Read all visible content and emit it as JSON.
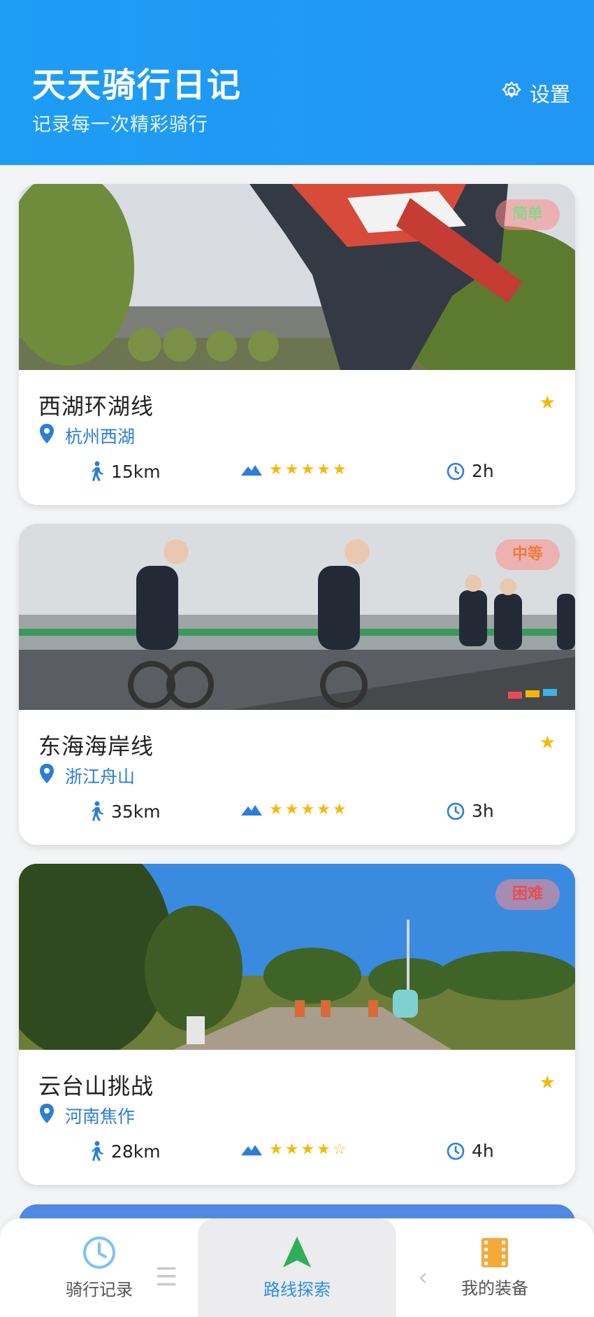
{
  "header": {
    "title": "天天骑行日记",
    "subtitle": "记录每一次精彩骑行",
    "settings_label": "设置",
    "settings_icon": "gear-icon"
  },
  "routes": [
    {
      "name": "西湖环湖线",
      "location": "杭州西湖",
      "difficulty_badge": "简单",
      "distance": "15km",
      "difficulty_stars": "★★★★★",
      "duration": "2h",
      "favorite": "★"
    },
    {
      "name": "东海海岸线",
      "location": "浙江舟山",
      "difficulty_badge": "中等",
      "distance": "35km",
      "difficulty_stars": "★★★★★",
      "duration": "3h",
      "favorite": "★"
    },
    {
      "name": "云台山挑战",
      "location": "河南焦作",
      "difficulty_badge": "困难",
      "distance": "28km",
      "difficulty_stars": "★★★★☆",
      "duration": "4h",
      "favorite": "★"
    }
  ],
  "tabbar": {
    "tabs": [
      {
        "label": "骑行记录",
        "icon": "clock-icon"
      },
      {
        "label": "路线探索",
        "icon": "navigation-arrow-icon"
      },
      {
        "label": "我的装备",
        "icon": "film-strip-icon"
      }
    ],
    "active": "路线探索"
  },
  "colors": {
    "header": "#1e9df5",
    "accent": "#2b7fd6",
    "star": "#f5b90a"
  }
}
